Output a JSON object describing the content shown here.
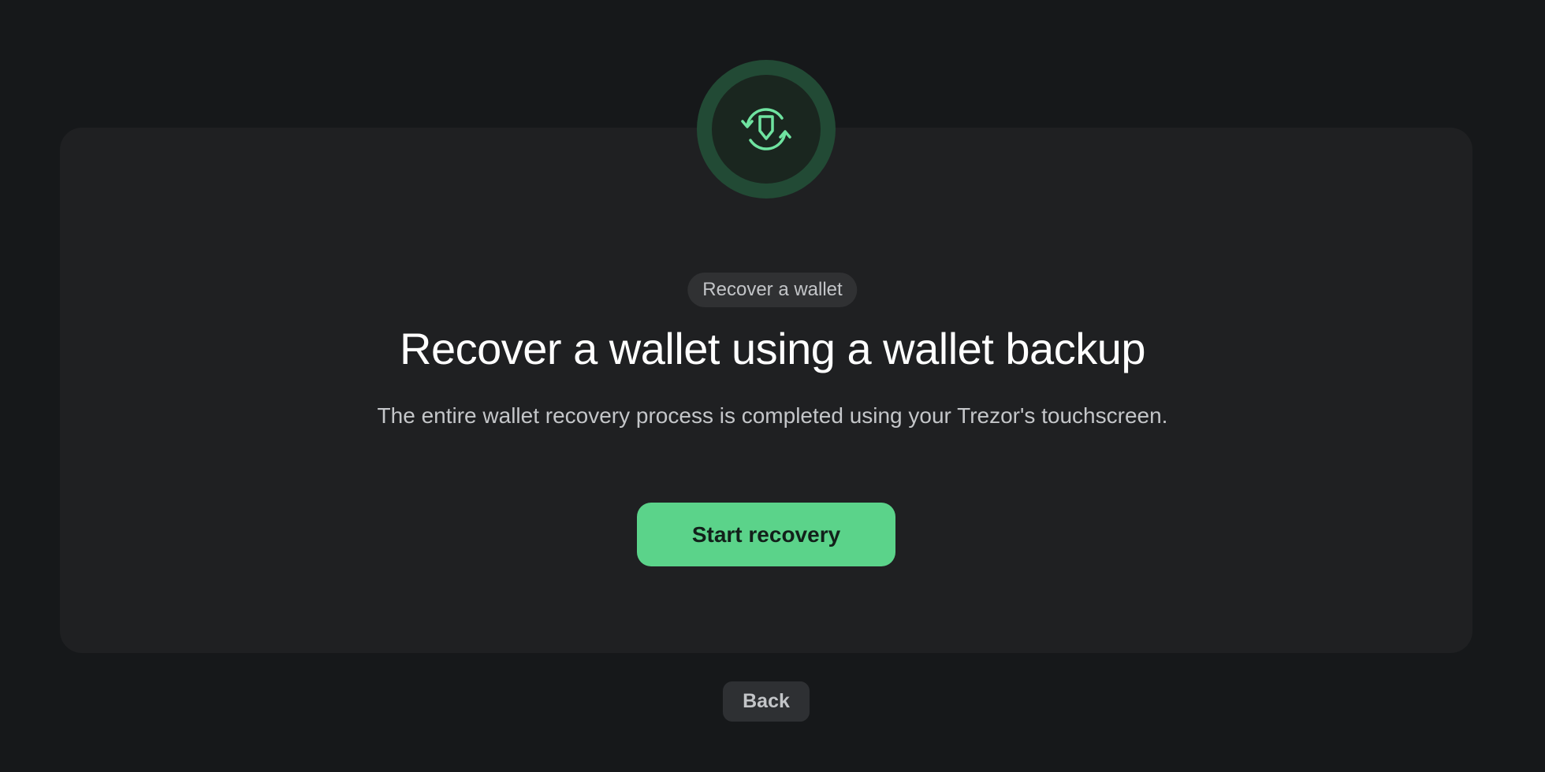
{
  "header": {
    "icon": "shield-refresh-icon",
    "tag_label": "Recover a wallet"
  },
  "main": {
    "title": "Recover a wallet using a wallet backup",
    "description": "The entire wallet recovery process is completed using your Trezor's touchscreen.",
    "primary_button_label": "Start recovery"
  },
  "footer": {
    "back_label": "Back"
  },
  "colors": {
    "background": "#16181a",
    "card": "#1f2022",
    "accent": "#5bd38a",
    "badge_ring": "#224a35"
  }
}
